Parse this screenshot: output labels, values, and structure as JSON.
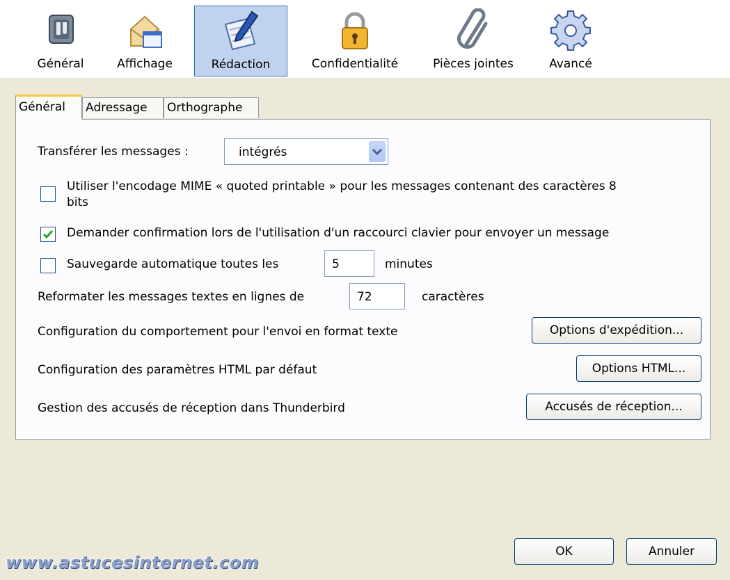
{
  "toolbar": {
    "items": [
      {
        "label": "Général",
        "icon": "general-icon"
      },
      {
        "label": "Affichage",
        "icon": "display-icon"
      },
      {
        "label": "Rédaction",
        "icon": "composition-icon",
        "active": true
      },
      {
        "label": "Confidentialité",
        "icon": "lock-icon"
      },
      {
        "label": "Pièces jointes",
        "icon": "paperclip-icon"
      },
      {
        "label": "Avancé",
        "icon": "gear-icon"
      }
    ]
  },
  "tabs": [
    {
      "label": "Général",
      "active": true
    },
    {
      "label": "Adressage"
    },
    {
      "label": "Orthographe"
    }
  ],
  "forward": {
    "label": "Transférer les messages :",
    "value": "intégrés"
  },
  "mime": {
    "line1": "Utiliser l'encodage MIME « quoted printable » pour les messages contenant des caractères 8",
    "line2": "bits",
    "checked": false
  },
  "confirm_shortcut": {
    "label": "Demander confirmation lors de l'utilisation d'un raccourci clavier pour envoyer un message",
    "checked": true
  },
  "autosave": {
    "label": "Sauvegarde automatique toutes les",
    "value": "5",
    "unit": "minutes",
    "checked": false
  },
  "wrap": {
    "label": "Reformater les messages textes en lignes de",
    "value": "72",
    "unit": "caractères"
  },
  "send_options": {
    "text": "Configuration du comportement pour l'envoi en format texte",
    "button": "Options d'expédition..."
  },
  "html_options": {
    "text": "Configuration des paramètres HTML par défaut",
    "button": "Options HTML..."
  },
  "receipts": {
    "text": "Gestion des accusés de réception dans Thunderbird",
    "button": "Accusés de réception..."
  },
  "footer": {
    "ok": "OK",
    "cancel": "Annuler",
    "watermark": "www.astucesinternet.com"
  },
  "colors": {
    "accent": "#316ac5",
    "tab_highlight": "#ffc83c",
    "dialog_bg": "#ece9d8"
  }
}
